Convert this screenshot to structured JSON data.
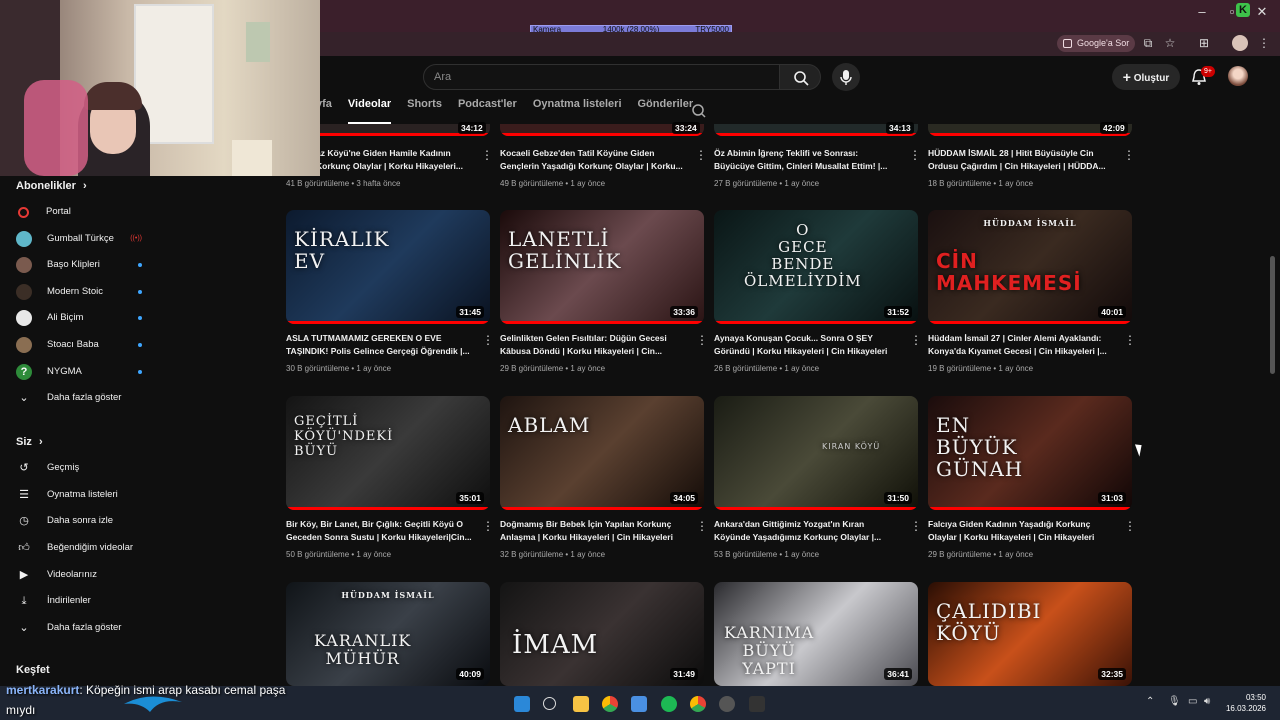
{
  "overlay": {
    "camera_label": "Kamera",
    "camera_value": "1400k (28.00%)",
    "camera_target": "TRY5000"
  },
  "browser": {
    "google_sor": "Google'a Sor"
  },
  "header": {
    "search_placeholder": "Ara",
    "create_label": "Oluştur",
    "notif_count": "9+"
  },
  "tabs": [
    {
      "label": "yfa"
    },
    {
      "label": "Videolar"
    },
    {
      "label": "Shorts"
    },
    {
      "label": "Podcast'ler"
    },
    {
      "label": "Oynatma listeleri"
    },
    {
      "label": "Gönderiler"
    }
  ],
  "sidebar": {
    "subs_header": "Abonelikler",
    "subs": [
      {
        "label": "Portal"
      },
      {
        "label": "Gumball Türkçe"
      },
      {
        "label": "Başo Klipleri"
      },
      {
        "label": "Modern Stoic"
      },
      {
        "label": "Ali Biçim"
      },
      {
        "label": "Stoacı Baba"
      },
      {
        "label": "NYGMA"
      },
      {
        "label": "Daha fazla göster"
      }
    ],
    "you_header": "Siz",
    "you": [
      {
        "label": "Geçmiş"
      },
      {
        "label": "Oynatma listeleri"
      },
      {
        "label": "Daha sonra izle"
      },
      {
        "label": "Beğendiğim videolar"
      },
      {
        "label": "Videolarınız"
      },
      {
        "label": "İndirilenler"
      },
      {
        "label": "Daha fazla göster"
      }
    ],
    "explore_header": "Keşfet"
  },
  "partial_row": [
    {
      "title": "az Köyü'ne Giden Hamile Kadının Korkunç Olaylar | Korku Hikayeleri...",
      "meta": "41 B görüntüleme • 3 hafta önce",
      "duration": "34:12"
    },
    {
      "title": "Kocaeli Gebze'den Tatil Köyüne Giden Gençlerin Yaşadığı Korkunç Olaylar | Korku...",
      "meta": "49 B görüntüleme • 1 ay önce",
      "duration": "33:24"
    },
    {
      "title": "Öz Abimin İğrenç Teklifi ve Sonrası: Büyücüye Gittim, Cinleri Musallat Ettim! |...",
      "meta": "27 B görüntüleme • 1 ay önce",
      "duration": "34:13"
    },
    {
      "title": "HÜDDAM İSMAİL 28 | Hitit Büyüsüyle Cin Ordusu Çağırdım | Cin Hikayeleri | HÜDDA...",
      "meta": "18 B görüntüleme • 1 ay önce",
      "duration": "42:09"
    }
  ],
  "videos": [
    {
      "thumb": "KİRALIK\nEV",
      "title": "ASLA TUTMAMAMIZ GEREKEN O EVE TAŞINDIK! Polis Gelince Gerçeği Öğrendik |...",
      "meta": "30 B görüntüleme • 1 ay önce",
      "duration": "31:45"
    },
    {
      "thumb": "LANETLİ\nGELİNLİK",
      "title": "Gelinlikten Gelen Fısıltılar: Düğün Gecesi Kâbusa Döndü | Korku Hikayeleri | Cin...",
      "meta": "29 B görüntüleme • 1 ay önce",
      "duration": "33:36"
    },
    {
      "thumb": "O\nGECE\nBENDE\nÖLMELİYDİM",
      "title": "Aynaya Konuşan Çocuk... Sonra O ŞEY Göründü | Korku Hikayeleri | Cin Hikayeleri",
      "meta": "26 B görüntüleme • 1 ay önce",
      "duration": "31:52"
    },
    {
      "thumb": "CİN\nMAHKEMESİ",
      "thumb_top": "HÜDDAM İSMAİL",
      "title": "Hüddam İsmail 27 | Cinler Alemi Ayaklandı: Konya'da Kıyamet Gecesi | Cin Hikayeleri |...",
      "meta": "19 B görüntüleme • 1 ay önce",
      "duration": "40:01"
    },
    {
      "thumb": "GEÇİTLİ\nKÖYÜ'NDEKİ\nBÜYÜ",
      "title": "Bir Köy, Bir Lanet, Bir Çığlık: Geçitli Köyü O Geceden Sonra Sustu | Korku Hikayeleri|Cin...",
      "meta": "50 B görüntüleme • 1 ay önce",
      "duration": "35:01"
    },
    {
      "thumb": "ABLAM",
      "title": "Doğmamış Bir Bebek İçin Yapılan Korkunç Anlaşma | Korku Hikayeleri | Cin Hikayeleri",
      "meta": "32 B görüntüleme • 1 ay önce",
      "duration": "34:05"
    },
    {
      "thumb": "KIRAN KÖYÜ",
      "title": "Ankara'dan Gittiğimiz Yozgat'ın Kıran Köyünde Yaşadığımız Korkunç Olaylar |...",
      "meta": "53 B görüntüleme • 1 ay önce",
      "duration": "31:50"
    },
    {
      "thumb": "EN\nBÜYÜK\nGÜNAH",
      "title": "Falcıya Giden Kadının Yaşadığı Korkunç Olaylar | Korku Hikayeleri | Cin Hikayeleri",
      "meta": "29 B görüntüleme • 1 ay önce",
      "duration": "31:03"
    },
    {
      "thumb": "KARANLIK\nMÜHÜR",
      "thumb_top": "HÜDDAM İSMAİL",
      "duration": "40:09"
    },
    {
      "thumb": "İMAM",
      "duration": "31:49"
    },
    {
      "thumb": "KARNIMA\nBÜYÜ\nYAPTI",
      "duration": "36:41"
    },
    {
      "thumb": "ÇALIDIBI\nKÖYÜ",
      "duration": "32:35"
    }
  ],
  "chat": {
    "user": "mertkarakurt",
    "message": ": Köpeğin ismi arap kasabı cemal paşa",
    "message_cont": "mıydı"
  },
  "clock": {
    "time": "03:50",
    "date": "16.03.2026"
  },
  "colors": {
    "bg": "#0f0f0f",
    "accent": "#ff0000",
    "tab_bar": "#3b1f2b"
  }
}
